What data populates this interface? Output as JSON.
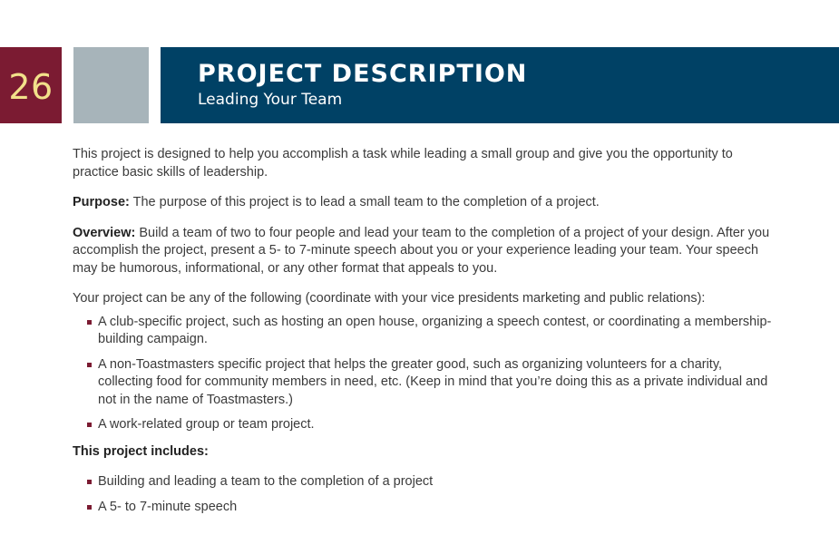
{
  "header": {
    "page_number": "26",
    "title": "PROJECT DESCRIPTION",
    "subtitle": "Leading Your Team"
  },
  "colors": {
    "page_number_bg": "#7b1b32",
    "page_number_text": "#f2e08a",
    "grey_block": "#a7b4ba",
    "banner_bg": "#004165",
    "bullet": "#7b1b32"
  },
  "body": {
    "intro": "This project is designed to help you accomplish a task while leading a small group and give you the opportunity to practice basic skills of leadership.",
    "purpose_label": "Purpose:",
    "purpose_text": " The purpose of this project is to lead a small team to the completion of a project.",
    "overview_label": "Overview:",
    "overview_text": " Build a team of two to four people and lead your team to the completion of a project of your design. After you accomplish the project, present a 5- to 7-minute speech about you or your experience leading your team. Your speech may be humorous, informational, or any other format that appeals to you.",
    "options_intro": "Your project can be any of the following (coordinate with your vice presidents marketing and public relations):",
    "options": [
      "A club-specific project, such as hosting an open house, organizing a speech contest, or coordinating a membership-building campaign.",
      "A non-Toastmasters specific project that helps the greater good, such as organizing volunteers for a charity, collecting food for community members in need, etc. (Keep in mind that you’re doing this as a private individual and not in the name of Toastmasters.)",
      "A work-related group or team project."
    ],
    "includes_heading": "This project includes:",
    "includes": [
      "Building and leading a team to the completion of a project",
      "A 5- to 7-minute speech"
    ]
  }
}
